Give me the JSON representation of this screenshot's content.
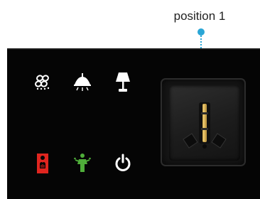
{
  "callout": {
    "label": "position 1"
  },
  "colors": {
    "callout": "#2aa6d6",
    "panel": "#050505",
    "dnd_button": "#e0251f",
    "service_button": "#4fae3a",
    "icon_white": "#ffffff",
    "pin_gold": "#c9a24a"
  },
  "panel": {
    "buttons": [
      {
        "name": "dnd-laundry-button",
        "icon": "laundry-icon"
      },
      {
        "name": "ceiling-light-button",
        "icon": "ceiling-lamp-icon"
      },
      {
        "name": "table-lamp-button",
        "icon": "table-lamp-icon"
      },
      {
        "name": "do-not-disturb-button",
        "icon": "do-not-disturb-icon"
      },
      {
        "name": "make-up-room-button",
        "icon": "make-up-room-icon"
      },
      {
        "name": "power-button",
        "icon": "power-icon"
      }
    ],
    "socket": {
      "icon": "universal-socket-icon"
    }
  }
}
